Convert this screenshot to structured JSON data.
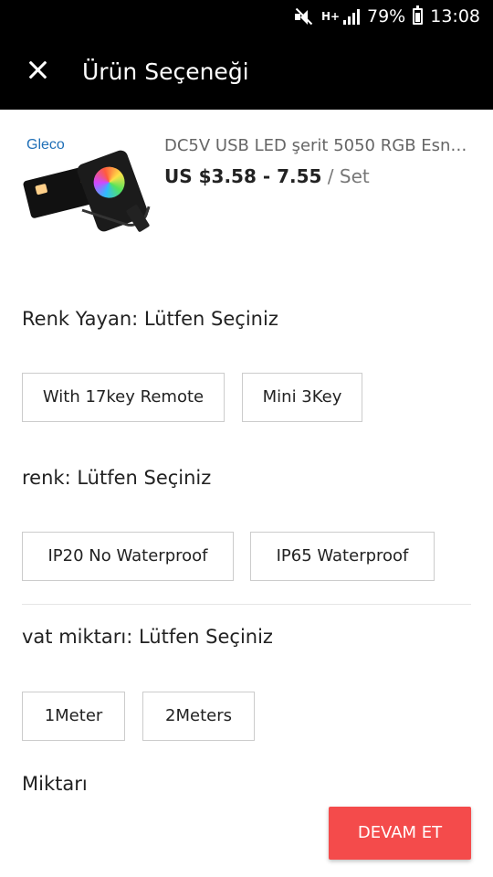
{
  "status_bar": {
    "mute_icon": "mute-icon",
    "network_label": "H+",
    "signal_icon": "signal-icon",
    "battery": "79%",
    "battery_icon": "battery-icon",
    "time": "13:08"
  },
  "app_bar": {
    "close_icon": "close-icon",
    "title": "Ürün Seçeneği"
  },
  "product": {
    "brand": "Gleco",
    "title": "DC5V USB LED şerit 5050 RGB Esne...",
    "price": "US $3.58 - 7.55",
    "unit": " / Set"
  },
  "options": [
    {
      "label": "Renk Yayan: Lütfen Seçiniz",
      "choices": [
        "With 17key Remote",
        "Mini 3Key"
      ]
    },
    {
      "label": "renk: Lütfen Seçiniz",
      "choices": [
        "IP20 No Waterproof",
        "IP65 Waterproof"
      ]
    },
    {
      "label": "vat miktarı: Lütfen Seçiniz",
      "choices": [
        "1Meter",
        "2Meters"
      ]
    }
  ],
  "quantity_label": "Miktarı",
  "continue_button": "DEVAM ET",
  "colors": {
    "accent": "#f44b4b",
    "header": "#000000"
  }
}
